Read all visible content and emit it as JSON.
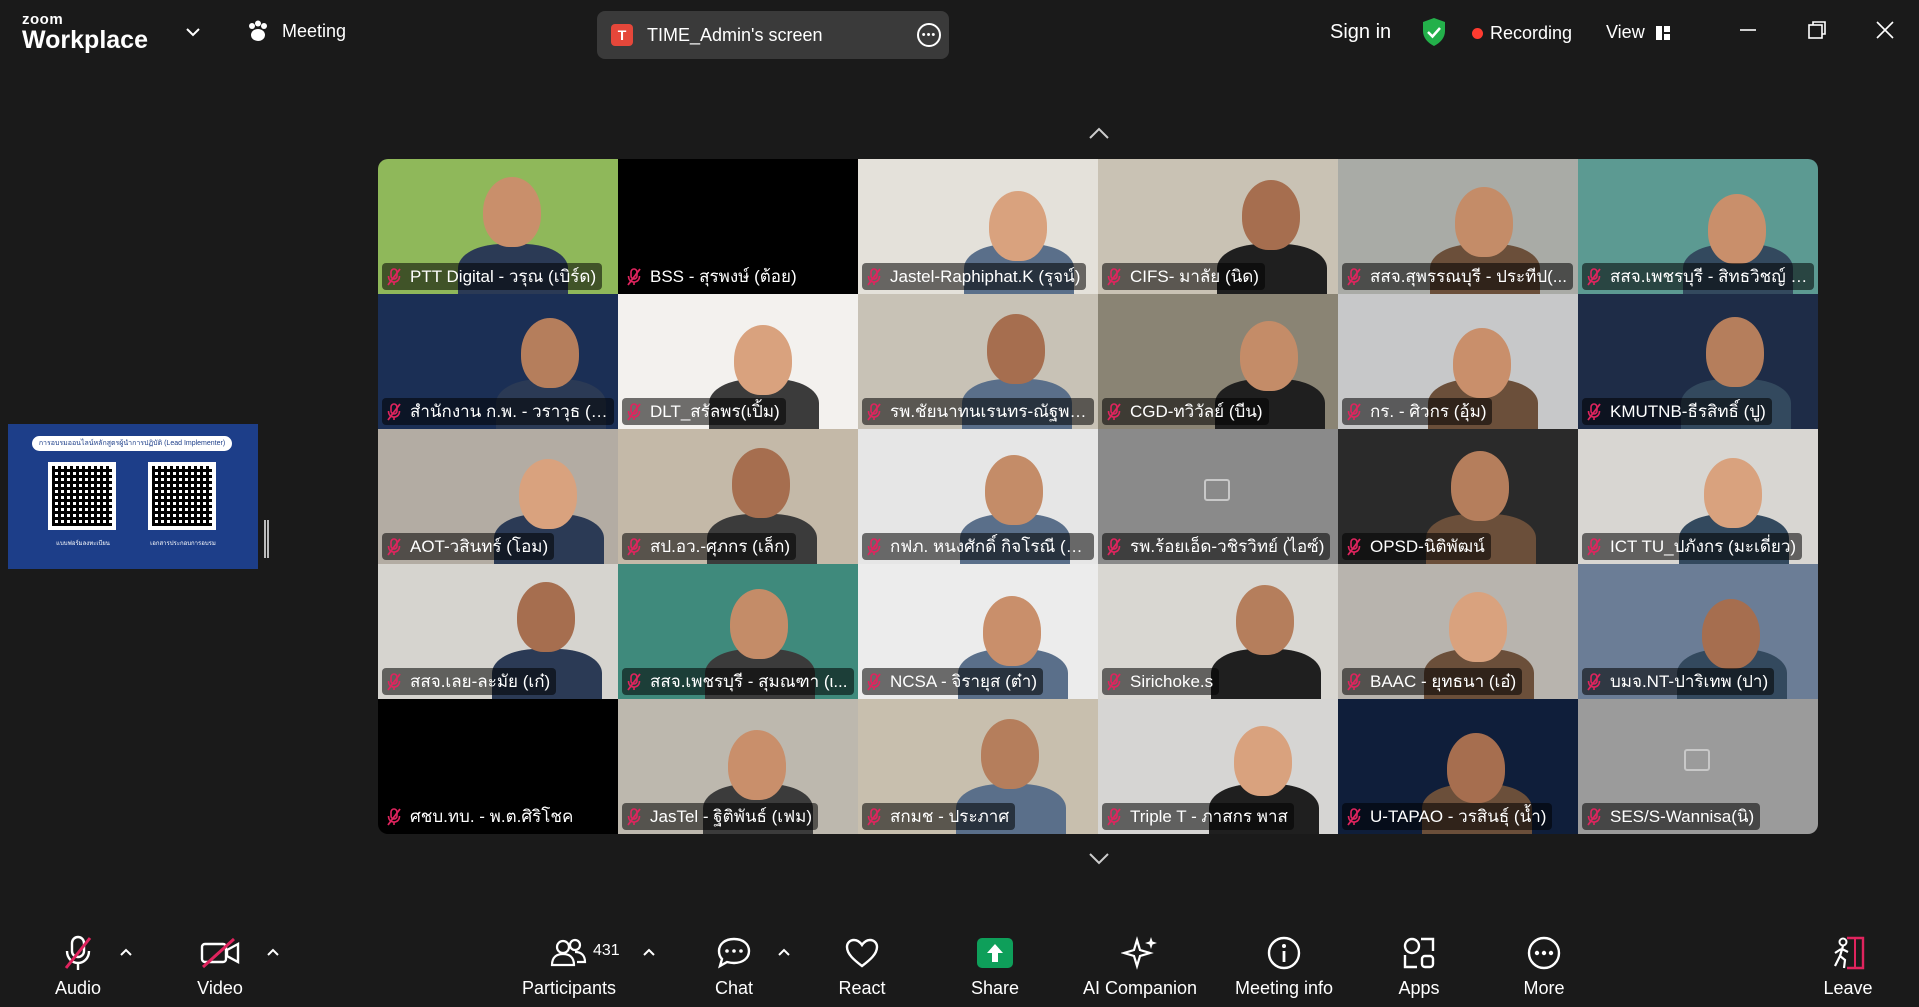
{
  "app": {
    "logo_small": "zoom",
    "logo_big": "Workplace",
    "meeting_label": "Meeting",
    "share_badge": "T",
    "share_title": "TIME_Admin's screen",
    "sign_in": "Sign in",
    "recording": "Recording",
    "view": "View"
  },
  "thumbnail": {
    "banner": "การอบรมออนไลน์หลักสูตรผู้นำการปฏิบัติ (Lead Implementer)",
    "qr1_label": "แบบฟอร์มลงทะเบียน",
    "qr2_label": "เอกสารประกอบการอบรม"
  },
  "participants": [
    {
      "name": "PTT Digital - วรุณ (เบิร์ด)",
      "bg": "#8fb85a"
    },
    {
      "name": "BSS - สุรพงษ์ (ต้อย)",
      "bg": "#000000"
    },
    {
      "name": "Jastel-Raphiphat.K (รุจน์)",
      "bg": "#e4e1da"
    },
    {
      "name": "CIFS- มาลัย (นิด)",
      "bg": "#c9c2b4"
    },
    {
      "name": "สสจ.สุพรรณบุรี - ประทีป(...",
      "bg": "#a9aba6"
    },
    {
      "name": "สสจ.เพชรบุรี - สิทธวิชญ์ (...",
      "bg": "#5c9a92"
    },
    {
      "name": "สำนักงาน ก.พ. - วราวุธ (บัว...",
      "bg": "#1b2f55"
    },
    {
      "name": "DLT_สรัลพร(เปิ้ม)",
      "bg": "#f3f1ee"
    },
    {
      "name": "รพ.ชัยนาทนเรนทร-ณัฐพล...",
      "bg": "#c8c2b6"
    },
    {
      "name": "CGD-ทวิวัลย์ (บีน)",
      "bg": "#8a8474"
    },
    {
      "name": "กร. - ศิวกร (อุ้ม)",
      "bg": "#c7c8c9"
    },
    {
      "name": "KMUTNB-ธีรสิทธิ์ (ปู)",
      "bg": "#1e2c47"
    },
    {
      "name": "AOT-วสินทร์ (โอม)",
      "bg": "#b3aca3"
    },
    {
      "name": "สป.อว.-ศุภกร (เล็ก)",
      "bg": "#c4b9a8"
    },
    {
      "name": "กฟภ. หนงศักดิ์ กิจโรณี (ห...",
      "bg": "#e6e6e6"
    },
    {
      "name": "รพ.ร้อยเอ็ด-วชิรวิทย์ (ไอซ์)",
      "bg": "#8a8a8a"
    },
    {
      "name": "OPSD-นิติพัฒน์",
      "bg": "#2a2a2a"
    },
    {
      "name": "ICT TU_ปภังกร (มะเดี่ยว)",
      "bg": "#d8d6d2"
    },
    {
      "name": "สสจ.เลย-ละมัย (เก๋)",
      "bg": "#d6d4cf"
    },
    {
      "name": "สสจ.เพชรบุรี - สุมณฑา (ι...",
      "bg": "#3f8a7c"
    },
    {
      "name": "NCSA - จิรายุส (ต๋า)",
      "bg": "#ececec"
    },
    {
      "name": "Sirichoke.s",
      "bg": "#d9d7d2"
    },
    {
      "name": "BAAC - ยุทธนา (เอ๋)",
      "bg": "#b8b4ae"
    },
    {
      "name": "บมจ.NT-ปาริเทพ (ปา)",
      "bg": "#6b7d96"
    },
    {
      "name": "ศชบ.ทบ. - พ.ต.ศิริโชค",
      "bg": "#000000"
    },
    {
      "name": "JasTel - ฐิติพันธ์ (เฟม)",
      "bg": "#bdb8ae"
    },
    {
      "name": "สกมช - ประภาศ",
      "bg": "#c8bfae"
    },
    {
      "name": "Triple T - ภาสกร พาส",
      "bg": "#d6d5d3"
    },
    {
      "name": "U-TAPAO - วรสินธุ์ (น้ำ)",
      "bg": "#0f1e3a"
    },
    {
      "name": "SES/S-Wannisa(นิ)",
      "bg": "#9b9b9b"
    }
  ],
  "toolbar": {
    "audio": "Audio",
    "video": "Video",
    "participants": "Participants",
    "participants_count": "431",
    "chat": "Chat",
    "react": "React",
    "share": "Share",
    "ai_companion": "AI Companion",
    "meeting_info": "Meeting info",
    "apps": "Apps",
    "more": "More",
    "leave": "Leave"
  },
  "colors": {
    "share_green": "#0e9f5a",
    "recording_red": "#ff3b30",
    "shield_green": "#23b04a",
    "muted_red": "#e0245e"
  }
}
